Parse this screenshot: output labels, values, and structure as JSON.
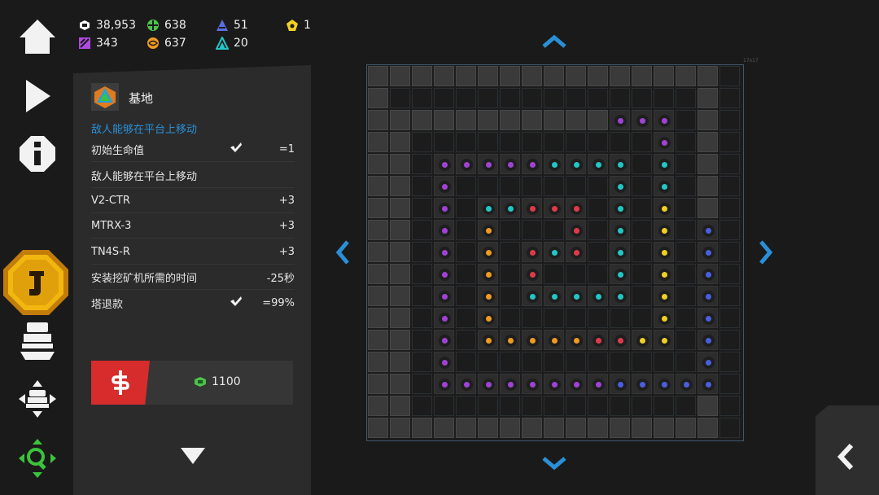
{
  "resources": [
    {
      "name": "bits",
      "value": "38,953",
      "color": "#ffffff",
      "icon": "bits-icon"
    },
    {
      "name": "matrix",
      "value": "638",
      "color": "#4cc24c",
      "icon": "matrix-icon"
    },
    {
      "name": "tensors",
      "value": "51",
      "color": "#5a6ee0",
      "icon": "tensor-icon"
    },
    {
      "name": "scalars",
      "value": "1",
      "color": "#f2d022",
      "icon": "scalar-icon"
    },
    {
      "name": "vectors",
      "value": "343",
      "color": "#b04ae0",
      "icon": "vector-icon"
    },
    {
      "name": "infiars",
      "value": "637",
      "color": "#f09a22",
      "icon": "infiar-icon"
    },
    {
      "name": "entropy",
      "value": "20",
      "color": "#22c6c6",
      "icon": "entropy-icon"
    }
  ],
  "panel": {
    "title": "基地",
    "subtitle": "敌人能够在平台上移动",
    "rows": [
      {
        "name": "初始生命值",
        "check": true,
        "value": "=1"
      },
      {
        "name": "敌人能够在平台上移动",
        "check": false,
        "value": ""
      },
      {
        "name": "V2-CTR",
        "check": false,
        "value": "+3"
      },
      {
        "name": "MTRX-3",
        "check": false,
        "value": "+3"
      },
      {
        "name": "TN4S-R",
        "check": false,
        "value": "+3"
      },
      {
        "name": "安装挖矿机所需的时间",
        "check": false,
        "value": "-25秒"
      },
      {
        "name": "塔退款",
        "check": true,
        "value": "=99%"
      }
    ],
    "price": "1100"
  },
  "map_label": "17x17",
  "colors": {
    "accent": "#2a8fd6",
    "sell": "#d62c2c",
    "panel": "#2b2b2b",
    "coin": "#f2b70f",
    "map_border": "#41566a"
  }
}
